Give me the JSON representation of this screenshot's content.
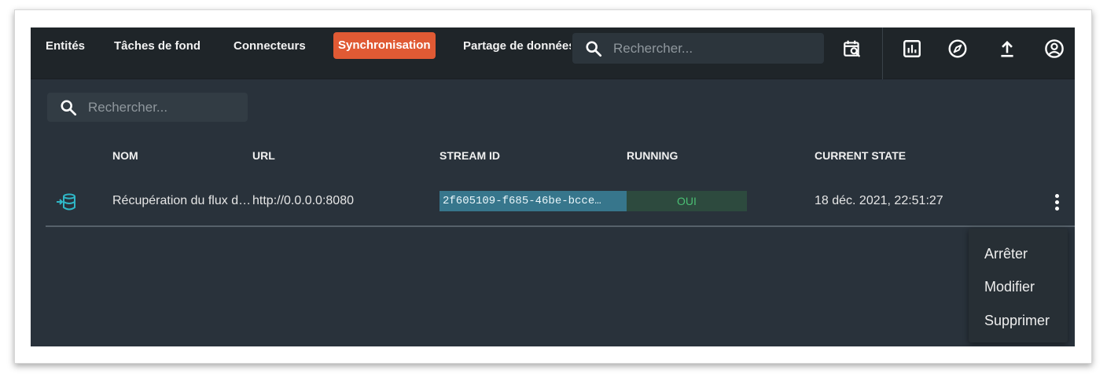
{
  "nav": {
    "items": [
      {
        "label": "Entités"
      },
      {
        "label": "Tâches de fond"
      },
      {
        "label": "Connecteurs"
      },
      {
        "label": "Synchronisation"
      },
      {
        "label": "Partage de données"
      }
    ],
    "active_index": 3
  },
  "top_search": {
    "placeholder": "Rechercher...",
    "icon": "search-icon"
  },
  "toolbar_icons": [
    "calendar-search-icon",
    "bar-chart-icon",
    "compass-icon",
    "upload-icon",
    "account-icon"
  ],
  "main_search": {
    "placeholder": "Rechercher...",
    "icon": "search-icon"
  },
  "table": {
    "headers": {
      "name": "NOM",
      "url": "URL",
      "stream_id": "STREAM ID",
      "running": "RUNNING",
      "current_state": "CURRENT STATE"
    },
    "rows": [
      {
        "icon": "stream-icon",
        "name": "Récupération du flux d…",
        "url": "http://0.0.0.0:8080",
        "stream_id": "2f605109-f685-46be-bcce…",
        "running": "OUI",
        "current_state": "18 déc. 2021, 22:51:27"
      }
    ]
  },
  "row_menu": {
    "items": [
      "Arrêter",
      "Modifier",
      "Supprimer"
    ]
  },
  "colors": {
    "accent": "#e05a34",
    "background": "#29323b",
    "topbar": "#1f2529",
    "stream_badge": "#37768c",
    "running_text": "#4bbf74"
  }
}
